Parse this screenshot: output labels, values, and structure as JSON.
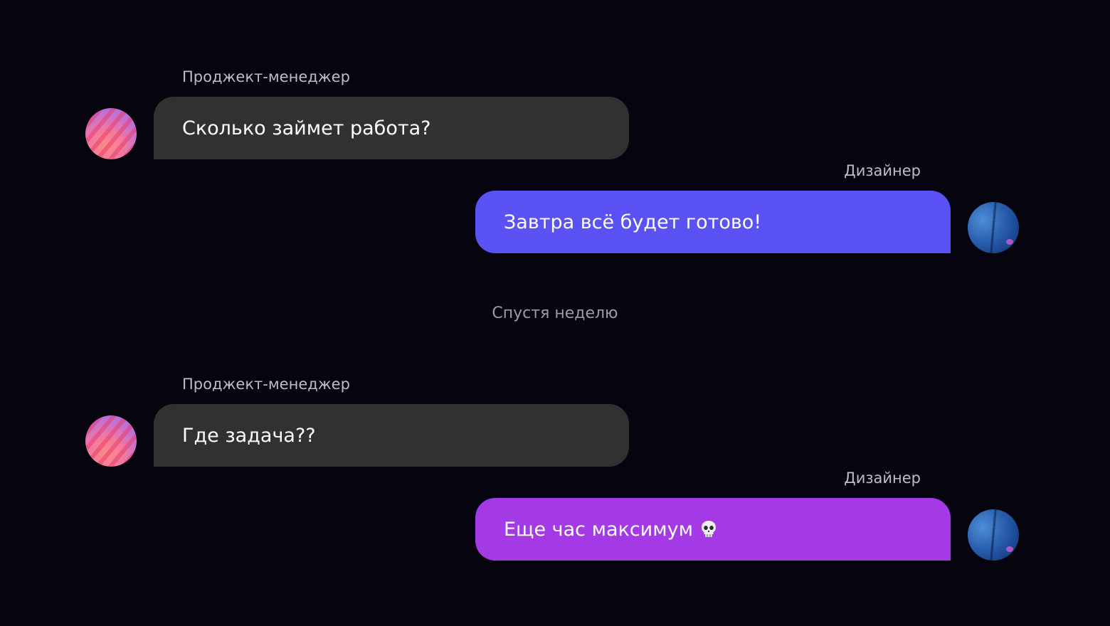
{
  "messages": [
    {
      "sender": "Проджект-менеджер",
      "text": "Сколько займет работа?",
      "direction": "incoming"
    },
    {
      "sender": "Дизайнер",
      "text": "Завтра всё будет готово!",
      "direction": "outgoing",
      "color": "#5b52f5"
    },
    {
      "sender": "Проджект-менеджер",
      "text": "Где задача??",
      "direction": "incoming"
    },
    {
      "sender": "Дизайнер",
      "text": "Еще час максимум",
      "direction": "outgoing",
      "color": "#a33ae6",
      "emoji_icon": "skull-icon"
    }
  ],
  "divider": "Спустя неделю",
  "colors": {
    "background": "#06050f",
    "incoming_bubble": "#313131",
    "outgoing_bubble_1": "#5b52f5",
    "outgoing_bubble_2": "#a33ae6"
  }
}
